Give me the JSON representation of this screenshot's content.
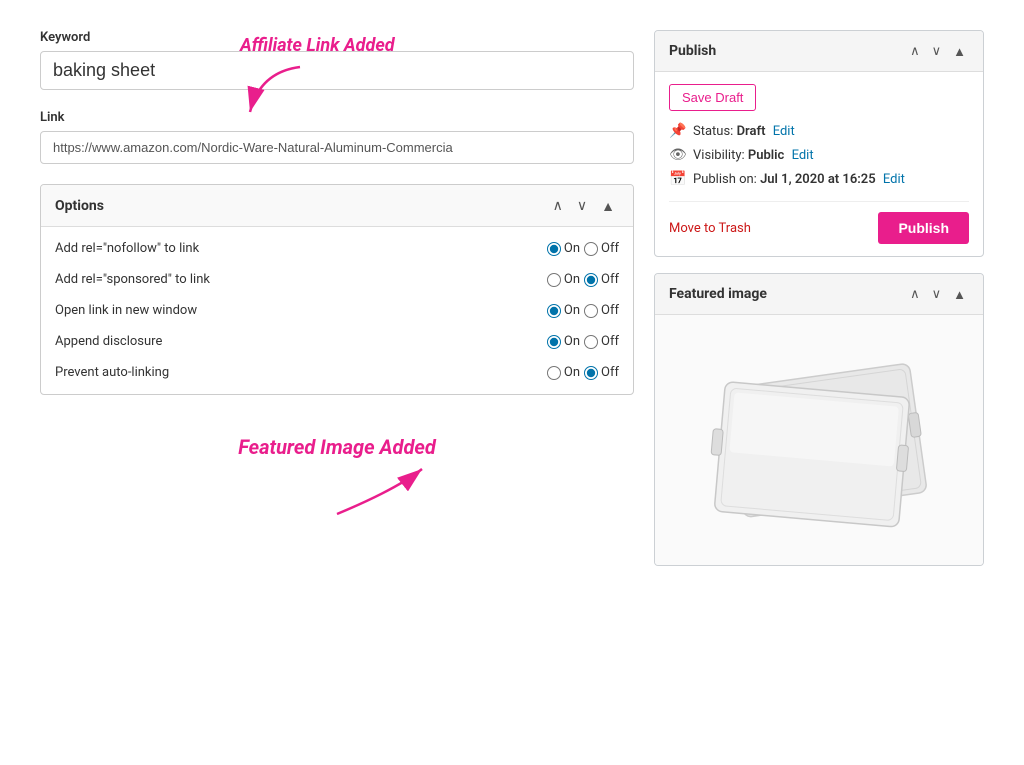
{
  "keyword": {
    "label": "Keyword",
    "value": "baking sheet"
  },
  "link": {
    "label": "Link",
    "value": "https://www.amazon.com/Nordic-Ware-Natural-Aluminum-Commercia",
    "placeholder": "https://..."
  },
  "affiliate_annotation": {
    "text": "Affiliate Link Added"
  },
  "options": {
    "title": "Options",
    "rows": [
      {
        "label": "Add rel=\"nofollow\" to link",
        "on_checked": true,
        "off_checked": false
      },
      {
        "label": "Add rel=\"sponsored\" to link",
        "on_checked": false,
        "off_checked": true
      },
      {
        "label": "Open link in new window",
        "on_checked": true,
        "off_checked": false
      },
      {
        "label": "Append disclosure",
        "on_checked": true,
        "off_checked": false
      },
      {
        "label": "Prevent auto-linking",
        "on_checked": false,
        "off_checked": true
      }
    ],
    "on_label": "On",
    "off_label": "Off"
  },
  "featured_annotation": {
    "text": "Featured Image Added"
  },
  "publish_panel": {
    "title": "Publish",
    "save_draft_label": "Save Draft",
    "status_label": "Status:",
    "status_value": "Draft",
    "status_edit": "Edit",
    "visibility_label": "Visibility:",
    "visibility_value": "Public",
    "visibility_edit": "Edit",
    "publish_on_label": "Publish on:",
    "publish_on_value": "Jul 1, 2020 at 16:25",
    "publish_on_edit": "Edit",
    "move_to_trash": "Move to Trash",
    "publish_btn": "Publish"
  },
  "featured_image_panel": {
    "title": "Featured image"
  },
  "icons": {
    "chevron_up": "∧",
    "chevron_down": "∨",
    "collapse": "▲",
    "pin": "📌",
    "eye": "👁",
    "calendar": "📅"
  }
}
